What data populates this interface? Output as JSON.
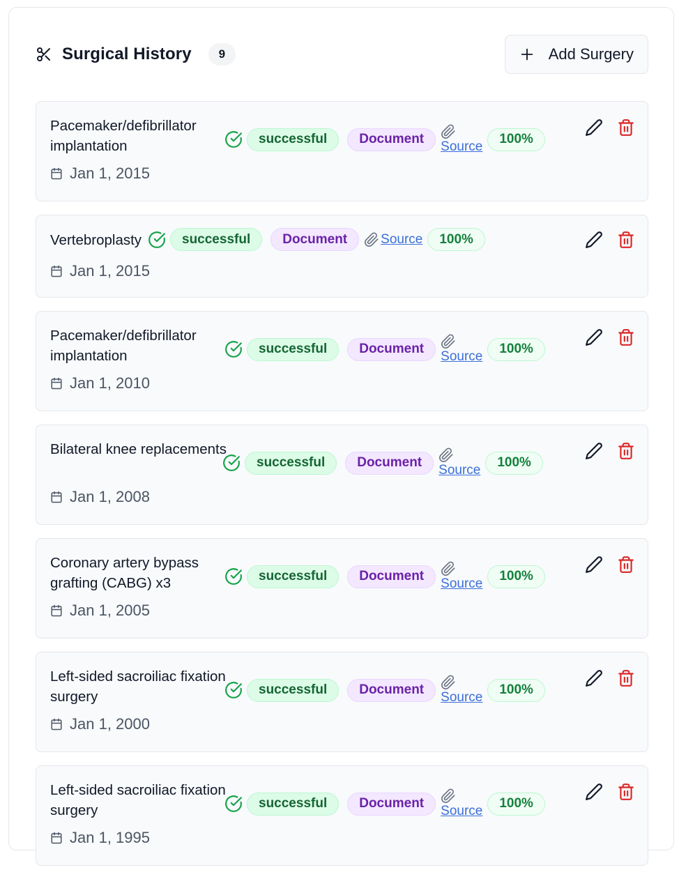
{
  "header": {
    "title": "Surgical History",
    "count": "9",
    "add_label": "Add Surgery"
  },
  "colors": {
    "success_bg": "#dcfce7",
    "success_text": "#166534",
    "doc_bg": "#f3e8ff",
    "doc_text": "#6b21a8",
    "link": "#2563eb",
    "delete": "#dc2626"
  },
  "surgeries": [
    {
      "name": "Pacemaker/defibrillator implantation",
      "date": "Jan 1, 2015",
      "status": "successful",
      "type": "Document",
      "source": "Source",
      "confidence": "100%"
    },
    {
      "name": "Vertebroplasty",
      "date": "Jan 1, 2015",
      "status": "successful",
      "type": "Document",
      "source": "Source",
      "confidence": "100%"
    },
    {
      "name": "Pacemaker/defibrillator implantation",
      "date": "Jan 1, 2010",
      "status": "successful",
      "type": "Document",
      "source": "Source",
      "confidence": "100%"
    },
    {
      "name": "Bilateral knee replacements",
      "date": "Jan 1, 2008",
      "status": "successful",
      "type": "Document",
      "source": "Source",
      "confidence": "100%"
    },
    {
      "name": "Coronary artery bypass grafting (CABG) x3",
      "date": "Jan 1, 2005",
      "status": "successful",
      "type": "Document",
      "source": "Source",
      "confidence": "100%"
    },
    {
      "name": "Left-sided sacroiliac fixation surgery",
      "date": "Jan 1, 2000",
      "status": "successful",
      "type": "Document",
      "source": "Source",
      "confidence": "100%"
    },
    {
      "name": "Left-sided sacroiliac fixation surgery",
      "date": "Jan 1, 1995",
      "status": "successful",
      "type": "Document",
      "source": "Source",
      "confidence": "100%"
    }
  ]
}
